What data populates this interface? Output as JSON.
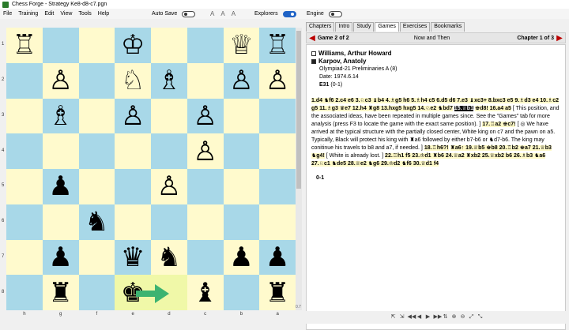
{
  "window": {
    "title": "Chess Forge - Strategy Ke8-d8-c7.pgn"
  },
  "menu": [
    "File",
    "Training",
    "Edit",
    "View",
    "Tools",
    "Help"
  ],
  "toolbar": {
    "autosave_label": "Auto Save",
    "explorers_label": "Explorers",
    "engine_label": "Engine",
    "font_buttons": [
      "A",
      "A",
      "A"
    ]
  },
  "board": {
    "ranks": [
      "1",
      "2",
      "3",
      "4",
      "5",
      "6",
      "7",
      "8"
    ],
    "files": [
      "h",
      "g",
      "f",
      "e",
      "d",
      "c",
      "b",
      "a"
    ],
    "rows": [
      [
        "♖",
        "",
        "",
        "♔",
        "",
        "",
        "♕",
        "♖"
      ],
      [
        "",
        "♙",
        "",
        "♘",
        "♗",
        "",
        "♙",
        "♙"
      ],
      [
        "",
        "♗",
        "",
        "♙",
        "",
        "♙",
        "",
        ""
      ],
      [
        "",
        "",
        "",
        "",
        "",
        "♙",
        "",
        ""
      ],
      [
        "",
        "♟",
        "",
        "",
        "♙",
        "",
        "",
        ""
      ],
      [
        "",
        "",
        "♞",
        "",
        "",
        "",
        "",
        ""
      ],
      [
        "",
        "♟",
        "",
        "♛",
        "♞",
        "",
        "♟",
        "♟"
      ],
      [
        "",
        "♜",
        "",
        "♚",
        "",
        "♝",
        "",
        "♜"
      ]
    ],
    "highlight": [
      [
        7,
        3
      ],
      [
        7,
        4
      ]
    ],
    "arrow_color": "#3cb371",
    "light_color": "#fffacd",
    "dark_color": "#a8d8e8",
    "corner": "0.7"
  },
  "tabs": [
    "Chapters",
    "Intro",
    "Study",
    "Games",
    "Exercises",
    "Bookmarks"
  ],
  "active_tab": "Games",
  "gamebar": {
    "game": "Game 2 of 2",
    "title": "Now and Then",
    "chapter": "Chapter 1 of 3"
  },
  "game": {
    "white": "Williams, Arthur Howard",
    "black": "Karpov, Anatoly",
    "event": "Olympiad-21 Preliminaries A (8)",
    "date": "Date: 1974.6.14",
    "eco": "E31",
    "eco_result": "(0-1)",
    "moves_1": "1.d4 ♞f6 2.c4 e6 3.♘c3 ♝b4 4.♗g5 h6 5.♗h4 c5 6.d5 d6 7.e3 ♝xc3+ 8.bxc3 e5 9.♗d3 e4 10.♗c2 g5 11.♗g3 ♛e7 12.h4 ♜g8 13.hxg5 hxg5 14.♘e2 ♞bd7",
    "current_move": "15.♕b1",
    "moves_2": "♚d8! 16.a4 a5",
    "comment_1": "[ This position, and the associated ideas, have been repeated in multiple games since. See the \"Games\" tab for more analysis (press F3 to locate the game with the exact same position). ]",
    "moves_3": "17.♖a2 ♚c7!",
    "comment_2": "[ ◎ We have arrived at the typical structure with the partially closed center, White king on c7 and the pawn on a5.  Typically, Black will protect his king with ♜a6 followed by either b7-b6 or ♞d7-b6. The king may conitinue his travels to b8 and a7, if needed. ]",
    "moves_4": "18.♖h6?!",
    "moves_5": "♜a6↑ 19.♕b5 ♚b8 20.♖b2 ♚a7 21.♕b3 ♞g4!",
    "comment_3": "[ White is already lost. ]",
    "moves_6": "22.♖h1 f5 23.♔d1 ♜b6 24.♕a2 ♜xb2 25.♕xb2 b6 26.♗b3 ♞a6 27.♘c1 ♞de5 28.♕e2 ♞g6 29.♔d2 ♞f6 30.♕d1 f4",
    "result": "0-1"
  },
  "bottom_buttons": [
    "⇱",
    "⇲",
    "◀◀",
    "◀",
    "▶",
    "▶▶",
    "⇅",
    "⊕",
    "⊖",
    "⤢",
    "⤡"
  ]
}
